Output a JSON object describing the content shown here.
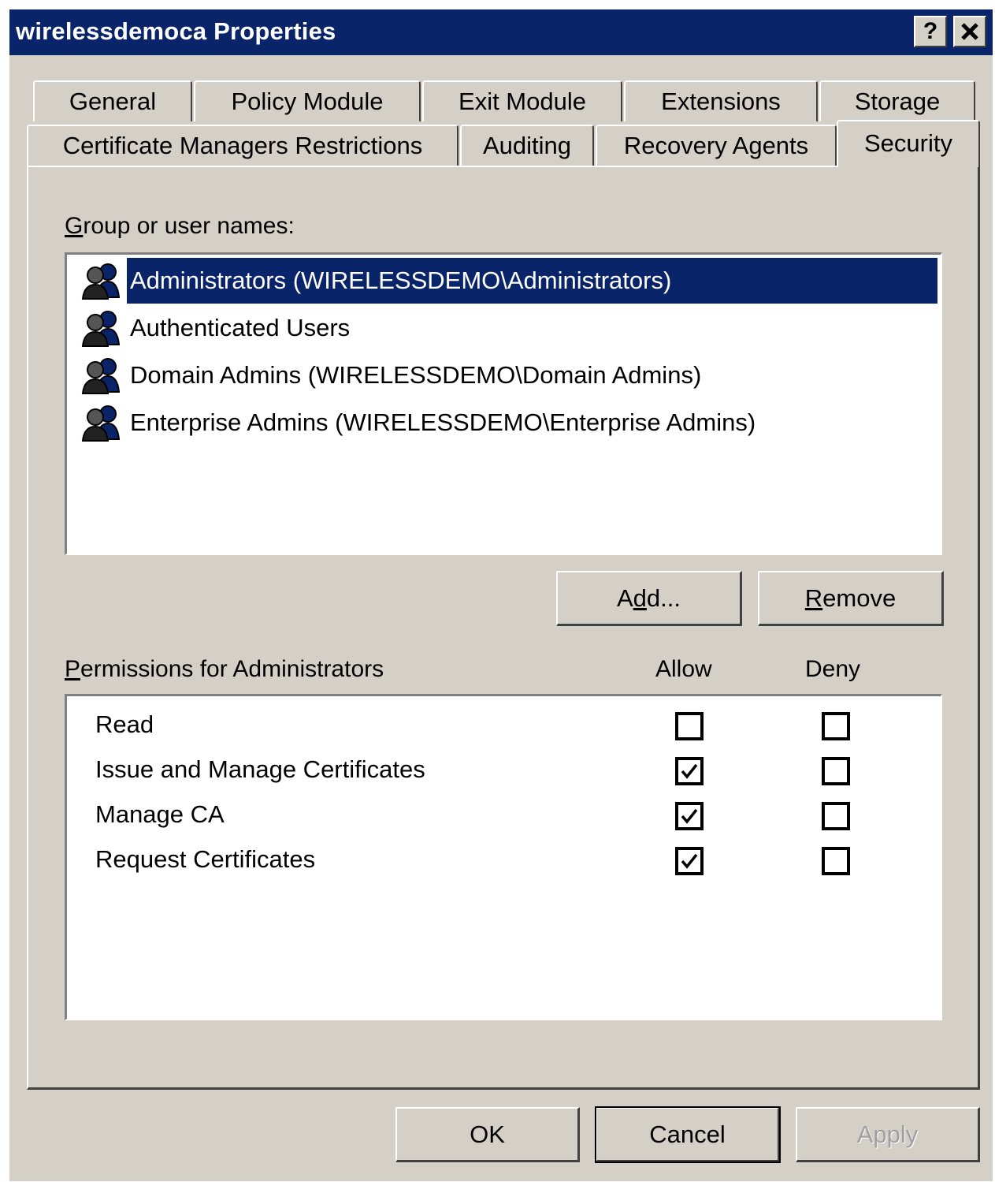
{
  "window": {
    "title": "wirelessdemoca Properties",
    "help_label": "?",
    "close_label": "✕"
  },
  "tabs": {
    "row1": [
      "General",
      "Policy Module",
      "Exit Module",
      "Extensions",
      "Storage"
    ],
    "row2": [
      "Certificate Managers Restrictions",
      "Auditing",
      "Recovery Agents",
      "Security"
    ],
    "active": "Security"
  },
  "security": {
    "group_label_accel": "G",
    "group_label_rest": "roup or user names:",
    "users": [
      {
        "label": "Administrators (WIRELESSDEMO\\Administrators)",
        "icon": "user-group-icon",
        "selected": true
      },
      {
        "label": "Authenticated Users",
        "icon": "user-group-icon",
        "selected": false
      },
      {
        "label": "Domain Admins (WIRELESSDEMO\\Domain Admins)",
        "icon": "user-group-icon",
        "selected": false
      },
      {
        "label": "Enterprise Admins (WIRELESSDEMO\\Enterprise Admins)",
        "icon": "user-group-icon",
        "selected": false
      }
    ],
    "add_button_pre": "A",
    "add_button_accel": "d",
    "add_button_post": "d...",
    "remove_button_accel": "R",
    "remove_button_rest": "emove",
    "perm_label_accel": "P",
    "perm_label_rest": "ermissions for Administrators",
    "allow_header": "Allow",
    "deny_header": "Deny",
    "permissions": [
      {
        "name": "Read",
        "allow": false,
        "deny": false
      },
      {
        "name": "Issue and Manage Certificates",
        "allow": true,
        "deny": false
      },
      {
        "name": "Manage CA",
        "allow": true,
        "deny": false
      },
      {
        "name": "Request Certificates",
        "allow": true,
        "deny": false
      }
    ]
  },
  "footer": {
    "ok_label": "OK",
    "cancel_label": "Cancel",
    "apply_label": "Apply"
  },
  "colors": {
    "titlebar": "#0a246a",
    "face": "#d4d0c8",
    "selection": "#0a246a"
  }
}
